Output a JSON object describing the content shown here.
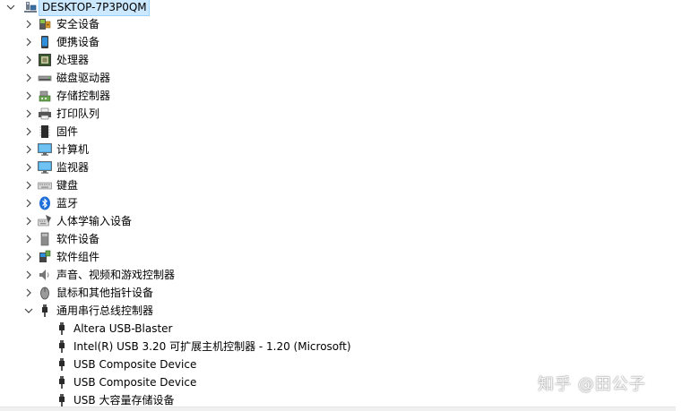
{
  "tree": {
    "root": {
      "label": "DESKTOP-7P3P0QM",
      "expanded": true,
      "icon": "computer-icon"
    },
    "categories": [
      {
        "label": "安全设备",
        "icon": "security-device-icon"
      },
      {
        "label": "便携设备",
        "icon": "portable-device-icon"
      },
      {
        "label": "处理器",
        "icon": "processor-icon"
      },
      {
        "label": "磁盘驱动器",
        "icon": "disk-drive-icon"
      },
      {
        "label": "存储控制器",
        "icon": "storage-controller-icon"
      },
      {
        "label": "打印队列",
        "icon": "printer-icon"
      },
      {
        "label": "固件",
        "icon": "firmware-icon"
      },
      {
        "label": "计算机",
        "icon": "monitor-icon"
      },
      {
        "label": "监视器",
        "icon": "monitor-icon"
      },
      {
        "label": "键盘",
        "icon": "keyboard-icon"
      },
      {
        "label": "蓝牙",
        "icon": "bluetooth-icon"
      },
      {
        "label": "人体学输入设备",
        "icon": "hid-icon"
      },
      {
        "label": "软件设备",
        "icon": "software-device-icon"
      },
      {
        "label": "软件组件",
        "icon": "software-component-icon"
      },
      {
        "label": "声音、视频和游戏控制器",
        "icon": "speaker-icon"
      },
      {
        "label": "鼠标和其他指针设备",
        "icon": "mouse-icon"
      },
      {
        "label": "通用串行总线控制器",
        "icon": "usb-icon",
        "expanded": true
      }
    ],
    "usb_children": [
      {
        "label": "Altera USB-Blaster",
        "icon": "usb-plug-icon"
      },
      {
        "label": "Intel(R) USB 3.20 可扩展主机控制器 - 1.20 (Microsoft)",
        "icon": "usb-plug-icon"
      },
      {
        "label": "USB Composite Device",
        "icon": "usb-plug-icon"
      },
      {
        "label": "USB Composite Device",
        "icon": "usb-plug-icon"
      },
      {
        "label": "USB 大容量存储设备",
        "icon": "usb-plug-icon"
      }
    ]
  },
  "watermark": {
    "text": "知乎 @田公子"
  },
  "colors": {
    "selection": "#cce8ff",
    "chevron": "#444444",
    "accent": "#0078d7"
  }
}
